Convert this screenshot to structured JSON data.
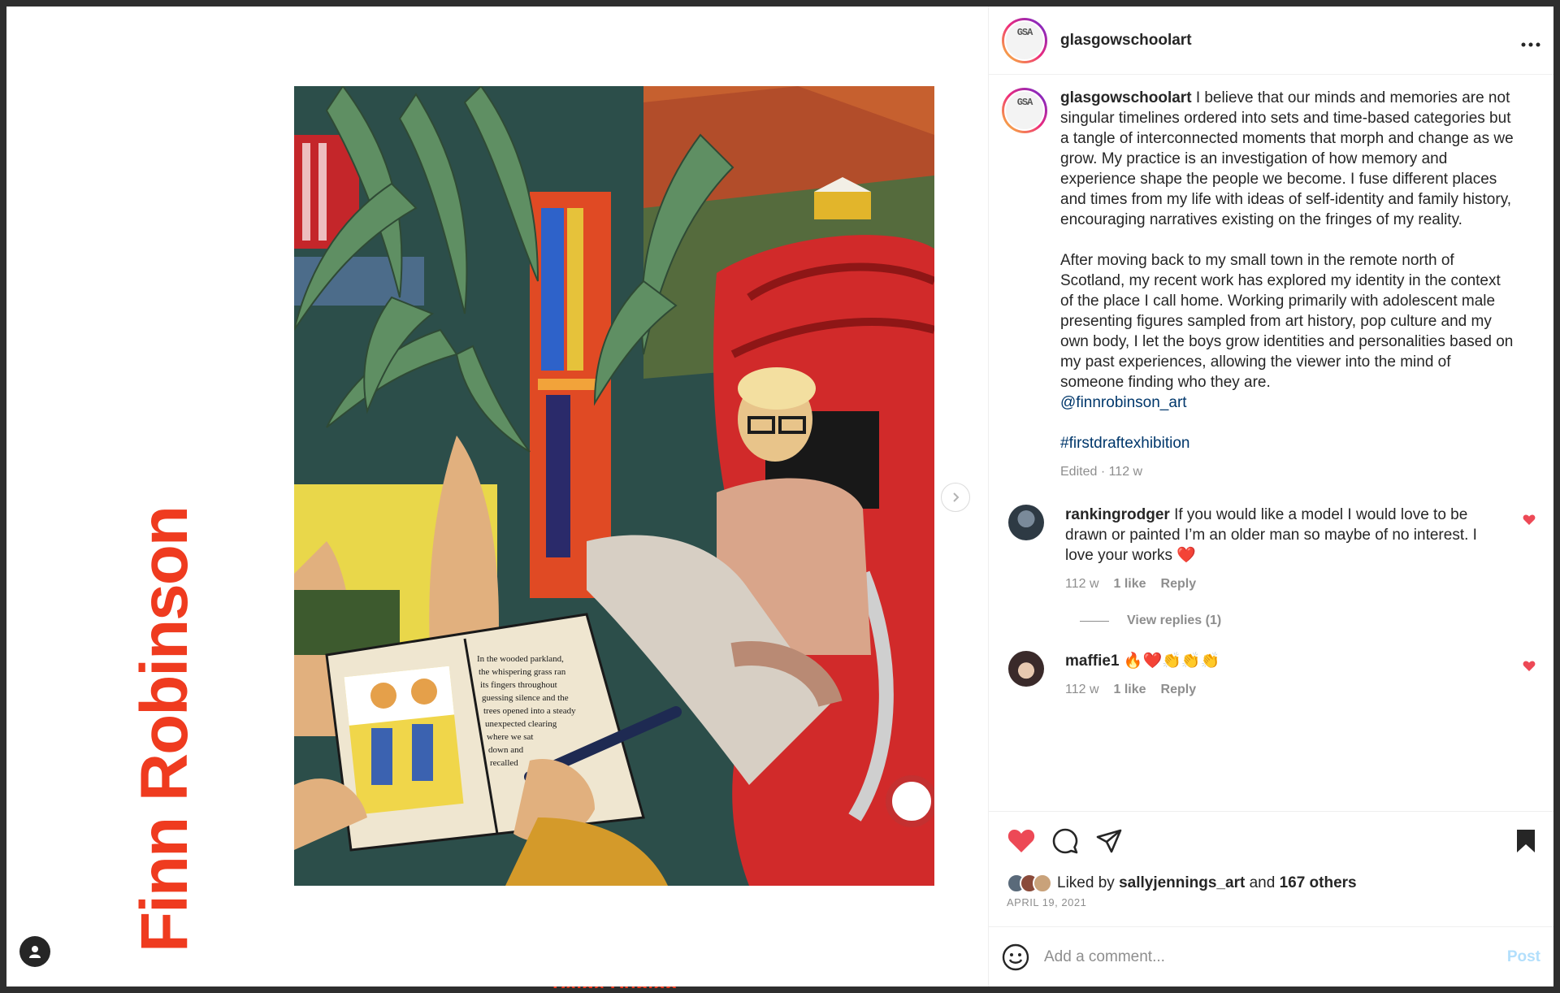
{
  "backdrop": {
    "bottom_text": "Paige Dunlop"
  },
  "media": {
    "side_title": "Finn Robinson",
    "next_icon": "chevron-right-icon",
    "profile_icon": "user-icon",
    "journal_text": [
      "In the wooded parkland,",
      "the whispering grass ran",
      "its fingers throughout",
      "guessing silence and the",
      "trees opened into a steady",
      "unexpected clearing",
      "where we sat",
      "down and",
      "recalled"
    ]
  },
  "post": {
    "username": "glasgowschoolart",
    "avatar_text": "GSA",
    "more_icon": "more-horizontal-icon",
    "caption": {
      "username": "glasgowschoolart",
      "text": "I believe that our minds and memories are not singular timelines ordered into sets and time-based categories but a tangle of interconnected moments that morph and change as we grow. My practice is an investigation of how memory and experience shape the people we become. I fuse different places and times from my life with ideas of self-identity and family history, encouraging narratives existing on the fringes of my reality.\n\nAfter moving back to my small town in the remote north of Scotland, my recent work has explored my identity in the context of the place I call home. Working primarily with adolescent male presenting figures sampled from art history, pop culture and my own body, I let the boys grow identities and personalities based on my past experiences, allowing the viewer into the mind of someone finding who they are.",
      "mention": "@finnrobinson_art",
      "hashtag": "#firstdraftexhibition",
      "meta": "Edited · 112 w"
    },
    "comments": [
      {
        "username": "rankingrodger",
        "text": "If you would like a model I would love to be drawn or painted I’m an older man so maybe of no interest. I love your works ❤️",
        "time": "112 w",
        "likes": "1 like",
        "reply": "Reply",
        "view_replies": "View replies (1)"
      },
      {
        "username": "maffie1",
        "text": "🔥❤️👏👏👏",
        "time": "112 w",
        "likes": "1 like",
        "reply": "Reply"
      }
    ],
    "likes": {
      "prefix": "Liked by",
      "user": "sallyjennings_art",
      "joiner": "and",
      "others": "167 others"
    },
    "date": "APRIL 19, 2021",
    "add_comment": {
      "placeholder": "Add a comment...",
      "post_label": "Post"
    },
    "colors": {
      "like_red": "#ed4956",
      "link_blue": "#00376b",
      "post_disabled": "#b2dffc",
      "name_orange": "#ef3b1f"
    }
  }
}
